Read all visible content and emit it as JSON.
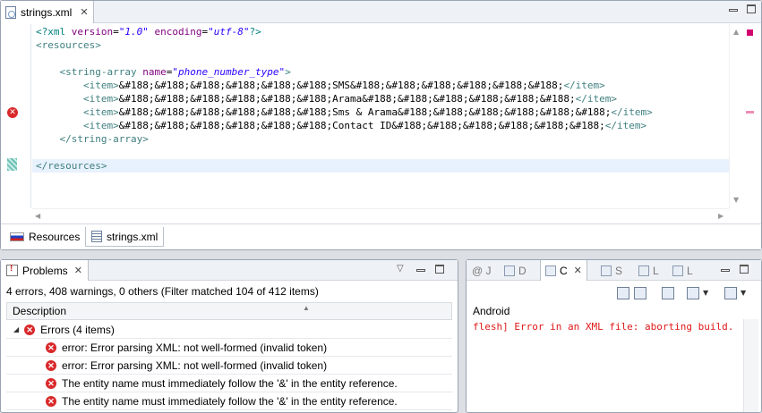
{
  "editor": {
    "tab_label": "strings.xml",
    "code_lines": [
      [
        {
          "c": "pi",
          "t": "<?xml "
        },
        {
          "c": "attr",
          "t": "version"
        },
        {
          "c": "txt",
          "t": "="
        },
        {
          "c": "val",
          "t": "\"1.0\""
        },
        {
          "c": "txt",
          "t": " "
        },
        {
          "c": "attr",
          "t": "encoding"
        },
        {
          "c": "txt",
          "t": "="
        },
        {
          "c": "val",
          "t": "\"utf-8\""
        },
        {
          "c": "pi",
          "t": "?>"
        }
      ],
      [
        {
          "c": "tag",
          "t": "<resources>"
        }
      ],
      [],
      [
        {
          "c": "txt",
          "t": "    "
        },
        {
          "c": "tag",
          "t": "<string-array "
        },
        {
          "c": "attr",
          "t": "name"
        },
        {
          "c": "txt",
          "t": "="
        },
        {
          "c": "val",
          "t": "\"phone_number_type\""
        },
        {
          "c": "tag",
          "t": ">"
        }
      ],
      [
        {
          "c": "txt",
          "t": "        "
        },
        {
          "c": "tag",
          "t": "<item>"
        },
        {
          "c": "txt",
          "t": "&#188;&#188;&#188;&#188;&#188;&#188;SMS&#188;&#188;&#188;&#188;&#188;&#188;"
        },
        {
          "c": "tag",
          "t": "</item>"
        }
      ],
      [
        {
          "c": "txt",
          "t": "        "
        },
        {
          "c": "tag",
          "t": "<item>"
        },
        {
          "c": "txt",
          "t": "&#188;&#188;&#188;&#188;&#188;&#188;Arama&#188;&#188;&#188;&#188;&#188;&#188;"
        },
        {
          "c": "tag",
          "t": "</item>"
        }
      ],
      [
        {
          "c": "txt",
          "t": "        "
        },
        {
          "c": "tag",
          "t": "<item>"
        },
        {
          "c": "txt",
          "t": "&#188;&#188;&#188;&#188;&#188;&#188;Sms & Arama&#188;&#188;&#188;&#188;&#188;&#188;"
        },
        {
          "c": "tag",
          "t": "</item>"
        }
      ],
      [
        {
          "c": "txt",
          "t": "        "
        },
        {
          "c": "tag",
          "t": "<item>"
        },
        {
          "c": "txt",
          "t": "&#188;&#188;&#188;&#188;&#188;&#188;Contact ID&#188;&#188;&#188;&#188;&#188;&#188;"
        },
        {
          "c": "tag",
          "t": "</item>"
        }
      ],
      [
        {
          "c": "txt",
          "t": "    "
        },
        {
          "c": "tag",
          "t": "</string-array>"
        }
      ],
      [],
      [
        {
          "c": "tag",
          "t": "</resources>"
        }
      ]
    ],
    "page_tabs": [
      "Resources",
      "strings.xml"
    ]
  },
  "problems": {
    "tab_label": "Problems",
    "summary": "4 errors, 408 warnings, 0 others (Filter matched 104 of 412 items)",
    "column_header": "Description",
    "group_label": "Errors (4 items)",
    "rows": [
      "error: Error parsing XML: not well-formed (invalid token)",
      "error: Error parsing XML: not well-formed (invalid token)",
      "The entity name must immediately follow the '&' in the entity reference.",
      "The entity name must immediately follow the '&' in the entity reference."
    ]
  },
  "console": {
    "tabs": [
      "@ J",
      "D",
      "C",
      "S",
      "L",
      "L"
    ],
    "label": "Android",
    "line": "flesh] Error in an XML file: aborting build."
  },
  "icons": {
    "error": "error-icon",
    "close": "close-icon",
    "minimize": "minimize-icon",
    "maximize": "maximize-icon"
  },
  "colors": {
    "error_red": "#d9292b",
    "xml_tag": "#3f7f7f",
    "xml_attr": "#7f007f",
    "xml_value": "#2a00ff",
    "current_line": "#e8f2fe"
  }
}
